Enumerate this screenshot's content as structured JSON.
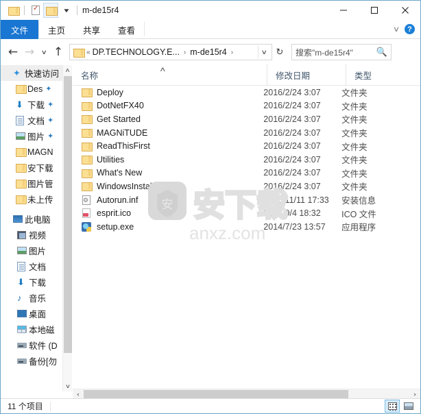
{
  "window": {
    "title": "m-de15r4",
    "quick_access_toolbar": [
      {
        "name": "folder-icon",
        "label": ""
      },
      {
        "name": "properties-icon",
        "label": ""
      },
      {
        "name": "new-folder-icon",
        "label": ""
      },
      {
        "name": "customize-dropdown",
        "label": ""
      }
    ],
    "controls": {
      "minimize": "—",
      "maximize": "☐",
      "close": "✕"
    }
  },
  "ribbon": {
    "tabs": [
      {
        "label": "文件",
        "active": true
      },
      {
        "label": "主页",
        "active": false
      },
      {
        "label": "共享",
        "active": false
      },
      {
        "label": "查看",
        "active": false
      }
    ],
    "collapse_label": "∨",
    "help_label": "?"
  },
  "addressbar": {
    "back": "←",
    "forward": "→",
    "recent": "∨",
    "up": "↑",
    "crumb_overflow": "«",
    "breadcrumbs": [
      {
        "label": "DP.TECHNOLOGY.E..."
      },
      {
        "label": "m-de15r4"
      }
    ],
    "crumb_sep": "›",
    "dropdown": "∨",
    "refresh": "↻"
  },
  "search": {
    "placeholder": "搜索\"m-de15r4\"",
    "icon": "search-icon"
  },
  "sidebar": {
    "sections": [
      {
        "root": {
          "label": "快速访问",
          "icon": "star-pin-icon",
          "selected": true
        },
        "items": [
          {
            "label": "Des",
            "icon": "folder-icon",
            "pinned": true
          },
          {
            "label": "下载",
            "icon": "download-icon",
            "pinned": true
          },
          {
            "label": "文档",
            "icon": "documents-icon",
            "pinned": true
          },
          {
            "label": "图片",
            "icon": "pictures-icon",
            "pinned": true
          },
          {
            "label": "MAGN",
            "icon": "folder-icon",
            "pinned": false
          },
          {
            "label": "安下载",
            "icon": "folder-icon",
            "pinned": false
          },
          {
            "label": "图片管",
            "icon": "folder-icon",
            "pinned": false
          },
          {
            "label": "未上传",
            "icon": "folder-icon",
            "pinned": false
          }
        ]
      },
      {
        "root": {
          "label": "此电脑",
          "icon": "computer-icon",
          "selected": false
        },
        "items": [
          {
            "label": "视频",
            "icon": "videos-icon",
            "pinned": false
          },
          {
            "label": "图片",
            "icon": "pictures-icon",
            "pinned": false
          },
          {
            "label": "文档",
            "icon": "documents-icon",
            "pinned": false
          },
          {
            "label": "下载",
            "icon": "download-icon",
            "pinned": false
          },
          {
            "label": "音乐",
            "icon": "music-icon",
            "pinned": false
          },
          {
            "label": "桌面",
            "icon": "desktop-icon",
            "pinned": false
          },
          {
            "label": "本地磁",
            "icon": "local-disk-icon",
            "pinned": false
          },
          {
            "label": "软件 (D",
            "icon": "drive-icon",
            "pinned": false
          },
          {
            "label": "备份[勿",
            "icon": "drive-icon",
            "pinned": false
          }
        ]
      }
    ],
    "scrollbar": {
      "up": "∧",
      "down": "∨"
    }
  },
  "filelist": {
    "columns": [
      {
        "key": "name",
        "label": "名称",
        "sorted": true,
        "sort_caret": "∧"
      },
      {
        "key": "date",
        "label": "修改日期",
        "sorted": false
      },
      {
        "key": "type",
        "label": "类型",
        "sorted": false
      }
    ],
    "rows": [
      {
        "name": "Deploy",
        "date": "2016/2/24 3:07",
        "type": "文件夹",
        "icon": "folder-icon"
      },
      {
        "name": "DotNetFX40",
        "date": "2016/2/24 3:07",
        "type": "文件夹",
        "icon": "folder-icon"
      },
      {
        "name": "Get Started",
        "date": "2016/2/24 3:07",
        "type": "文件夹",
        "icon": "folder-icon"
      },
      {
        "name": "MAGNiTUDE",
        "date": "2016/2/24 3:07",
        "type": "文件夹",
        "icon": "folder-icon"
      },
      {
        "name": "ReadThisFirst",
        "date": "2016/2/24 3:07",
        "type": "文件夹",
        "icon": "folder-icon"
      },
      {
        "name": "Utilities",
        "date": "2016/2/24 3:07",
        "type": "文件夹",
        "icon": "folder-icon"
      },
      {
        "name": "What's New",
        "date": "2016/2/24 3:07",
        "type": "文件夹",
        "icon": "folder-icon"
      },
      {
        "name": "WindowsInstaller3_1",
        "date": "2016/2/24 3:07",
        "type": "文件夹",
        "icon": "folder-icon"
      },
      {
        "name": "Autorun.inf",
        "date": "2015/11/11 17:33",
        "type": "安装信息",
        "icon": "inf-file-icon"
      },
      {
        "name": "esprit.ico",
        "date": "2015/9/4 18:32",
        "type": "ICO 文件",
        "icon": "ico-file-icon"
      },
      {
        "name": "setup.exe",
        "date": "2014/7/23 13:57",
        "type": "应用程序",
        "icon": "exe-file-icon"
      }
    ],
    "hscroll": {
      "left": "‹",
      "right": "›"
    }
  },
  "watermark": {
    "text_cn": "安下载",
    "text_url": "anxz.com",
    "badge_char": "安",
    "color": "#e2e2e2"
  },
  "statusbar": {
    "item_count": "11 个项目",
    "views": [
      {
        "name": "details-view-button",
        "active": true
      },
      {
        "name": "large-icons-view-button",
        "active": false
      }
    ]
  },
  "colors": {
    "accent": "#1976d2",
    "window_border": "#6ba8c9",
    "folder_yellow": "#fbdf93",
    "header_text": "#41566b"
  }
}
